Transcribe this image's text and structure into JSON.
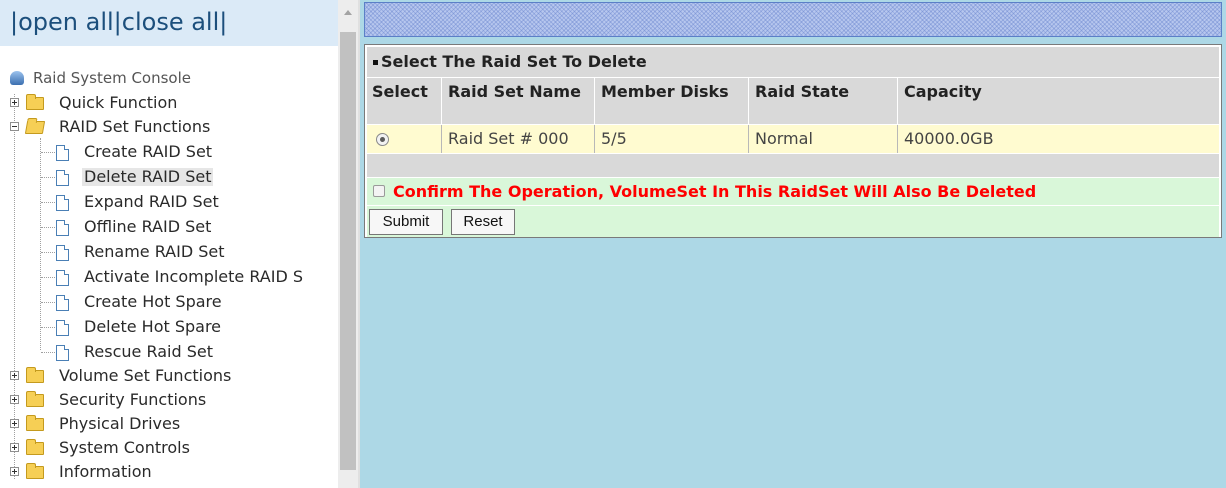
{
  "nav": {
    "open_all": "open all",
    "close_all": "close all",
    "separator": "|"
  },
  "tree": {
    "root": "Raid System Console",
    "quick_function": "Quick Function",
    "raid_set_functions": "RAID Set Functions",
    "raid_children": [
      "Create RAID Set",
      "Delete RAID Set",
      "Expand RAID Set",
      "Offline RAID Set",
      "Rename RAID Set",
      "Activate Incomplete RAID S",
      "Create Hot Spare",
      "Delete Hot Spare",
      "Rescue Raid Set"
    ],
    "selected_item": "Delete RAID Set",
    "collapsed_groups": [
      "Volume Set Functions",
      "Security Functions",
      "Physical Drives",
      "System Controls",
      "Information"
    ]
  },
  "form": {
    "title": "Select The Raid Set To Delete",
    "columns": [
      "Select",
      "Raid Set Name",
      "Member Disks",
      "Raid State",
      "Capacity"
    ],
    "rows": [
      {
        "selected": true,
        "name": "Raid Set # 000",
        "member_disks": "5/5",
        "state": "Normal",
        "capacity": "40000.0GB"
      }
    ],
    "confirm_label": "Confirm The Operation, VolumeSet In This RaidSet Will Also Be Deleted",
    "confirm_checked": false,
    "submit_label": "Submit",
    "reset_label": "Reset"
  },
  "colors": {
    "content_background": "#add8e6",
    "header_gray": "#d9d9d9",
    "data_row": "#fffbd0",
    "confirm_row": "#d9f7d9",
    "warning_text": "#ff0000",
    "nav_link": "#1c4f7c"
  },
  "icons": {
    "root": "raid-console-icon",
    "group": "folder-icon",
    "leaf": "page-icon",
    "expander": "plus-minus-box-icon"
  }
}
